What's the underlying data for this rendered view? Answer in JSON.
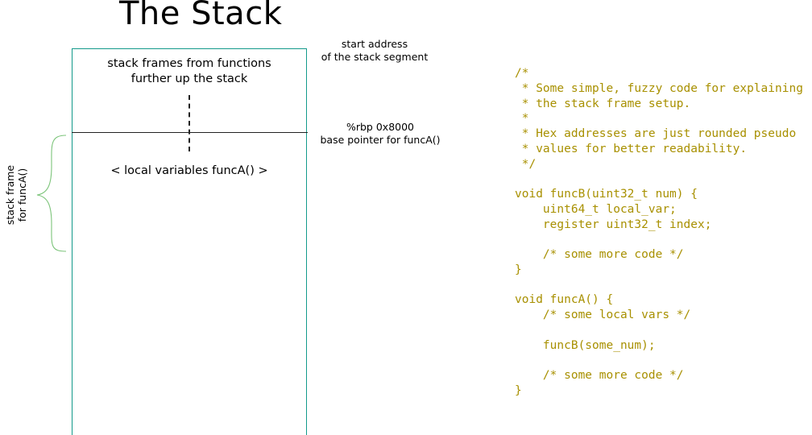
{
  "title": "The Stack",
  "stack": {
    "upper_frames_line1": "stack frames from functions",
    "upper_frames_line2": "further up the stack",
    "local_vars_label": "< local variables funcA() >"
  },
  "annotations": {
    "start_address_line1": "start address",
    "start_address_line2": "of the stack segment",
    "rbp_line1": "%rbp 0x8000",
    "rbp_line2": "base pointer for funcA()",
    "frame_label_line1": "stack frame",
    "frame_label_line2": "for funcA()"
  },
  "colors": {
    "stack_border": "#139a8b",
    "brace": "#7cc47a",
    "code_text": "#a89000"
  },
  "code_lines": [
    "/*",
    " * Some simple, fuzzy code for explaining",
    " * the stack frame setup.",
    " *",
    " * Hex addresses are just rounded pseudo",
    " * values for better readability.",
    " */",
    "",
    "void funcB(uint32_t num) {",
    "    uint64_t local_var;",
    "    register uint32_t index;",
    "",
    "    /* some more code */",
    "}",
    "",
    "void funcA() {",
    "    /* some local vars */",
    "",
    "    funcB(some_num);",
    "",
    "    /* some more code */",
    "}"
  ]
}
